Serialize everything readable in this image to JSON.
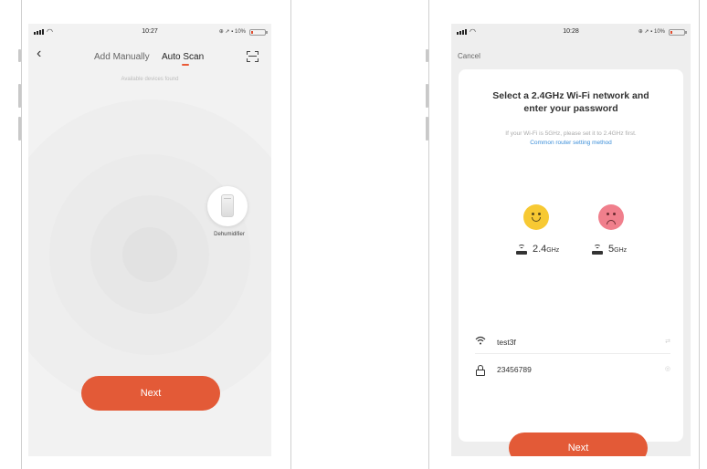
{
  "left_phone": {
    "status": {
      "time": "10:27",
      "battery": "10%"
    },
    "nav": {
      "back_glyph": "‹",
      "tabs": [
        "Add Manually",
        "Auto Scan"
      ],
      "active_tab": "Auto Scan"
    },
    "found_text": "Available devices found",
    "device": {
      "label": "Dehumidifier",
      "icon": "dehumidifier-icon"
    },
    "next_label": "Next"
  },
  "right_phone": {
    "status": {
      "time": "10:28",
      "battery": "10%"
    },
    "cancel_label": "Cancel",
    "title_line1": "Select a 2.4GHz Wi-Fi network and",
    "title_line2": "enter your password",
    "hint": "If your Wi-Fi is 5GHz, please set it to 2.4GHz first.",
    "hint_link": "Common router setting method",
    "bands": [
      {
        "value": "2.4",
        "unit": "GHz",
        "face": "happy"
      },
      {
        "value": "5",
        "unit": "GHz",
        "face": "sad"
      }
    ],
    "wifi_name": "test3f",
    "password": "23456789",
    "next_label": "Next"
  },
  "colors": {
    "accent": "#e35a37",
    "link": "#3b8ed8",
    "happy": "#f7c933",
    "sad": "#f07f8c"
  }
}
